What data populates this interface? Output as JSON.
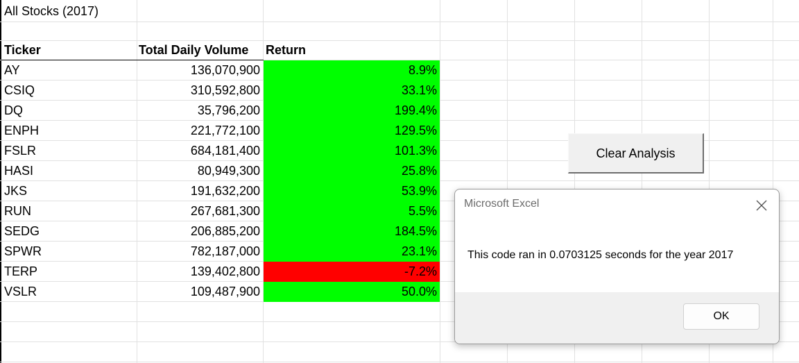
{
  "sheet": {
    "title": "All Stocks (2017)",
    "headers": {
      "ticker": "Ticker",
      "volume": "Total Daily Volume",
      "return": "Return"
    },
    "rows": [
      {
        "ticker": "AY",
        "volume": "136,070,900",
        "return": "8.9%",
        "status": "positive"
      },
      {
        "ticker": "CSIQ",
        "volume": "310,592,800",
        "return": "33.1%",
        "status": "positive"
      },
      {
        "ticker": "DQ",
        "volume": "35,796,200",
        "return": "199.4%",
        "status": "positive"
      },
      {
        "ticker": "ENPH",
        "volume": "221,772,100",
        "return": "129.5%",
        "status": "positive"
      },
      {
        "ticker": "FSLR",
        "volume": "684,181,400",
        "return": "101.3%",
        "status": "positive"
      },
      {
        "ticker": "HASI",
        "volume": "80,949,300",
        "return": "25.8%",
        "status": "positive"
      },
      {
        "ticker": "JKS",
        "volume": "191,632,200",
        "return": "53.9%",
        "status": "positive"
      },
      {
        "ticker": "RUN",
        "volume": "267,681,300",
        "return": "5.5%",
        "status": "positive"
      },
      {
        "ticker": "SEDG",
        "volume": "206,885,200",
        "return": "184.5%",
        "status": "positive"
      },
      {
        "ticker": "SPWR",
        "volume": "782,187,000",
        "return": "23.1%",
        "status": "positive"
      },
      {
        "ticker": "TERP",
        "volume": "139,402,800",
        "return": "-7.2%",
        "status": "negative"
      },
      {
        "ticker": "VSLR",
        "volume": "109,487,900",
        "return": "50.0%",
        "status": "positive"
      }
    ]
  },
  "colors": {
    "positive_fill": "#00ff00",
    "negative_fill": "#ff0000",
    "gridline": "#e1e1e1"
  },
  "clear_button": {
    "label": "Clear Analysis"
  },
  "dialog": {
    "title": "Microsoft Excel",
    "message": "This code ran in 0.0703125 seconds for the year 2017",
    "ok_label": "OK",
    "close_icon": "close-icon"
  }
}
